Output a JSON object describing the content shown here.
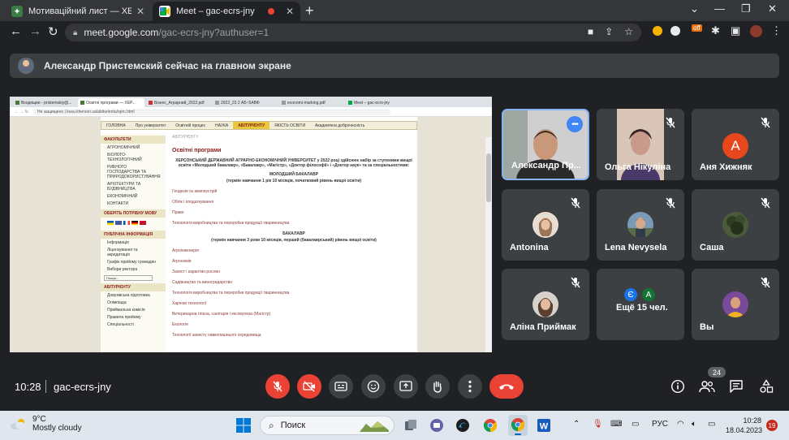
{
  "browser": {
    "tabs": [
      {
        "title": "Мотиваційний лист — ХЕРСОНСЬ",
        "active": false
      },
      {
        "title": "Meet – gac-ecrs-jny",
        "active": true
      }
    ],
    "url_host": "meet.google.com",
    "url_path": "/gac-ecrs-jny?authuser=1",
    "ext_badge": "off"
  },
  "meet": {
    "presenter_banner": "Александр Пристемский сейчас на главном экране",
    "clock": "10:28",
    "meeting_code": "gac-ecrs-jny",
    "participants_count": "24",
    "participants": [
      {
        "name": "Александр Пр...",
        "speaking": true
      },
      {
        "name": "Ольга Нікуліна"
      },
      {
        "name": "Аня Хижняк",
        "letter": "А"
      },
      {
        "name": "Antonina"
      },
      {
        "name": "Lena Nevysela"
      },
      {
        "name": "Саша"
      },
      {
        "name": "Аліна Приймак"
      },
      {
        "name": "Ещё 15 чел.",
        "letters": [
          "Є",
          "А"
        ]
      },
      {
        "name": "Вы"
      }
    ],
    "colors": {
      "accent": "#8ab4f8",
      "danger": "#ea4335",
      "tile": "#3c4043"
    }
  },
  "shared_screen": {
    "tabs": [
      "Входящие - pristemskiy@...",
      "Освітні програми — ХЕР...",
      "Бізнес_Аграрний_2022.pdf",
      "2022_23 2 АБ~5АВФ",
      "economi-marking.pdf",
      "Meet – gac-ecrs-jny"
    ],
    "url": "Не защищено | ksau.kherson.ua/abiturientu/oprc.html",
    "nav": [
      "ГОЛОВНА",
      "Про університет",
      "Освітній процес",
      "НАУКА",
      "АБІТУРІЄНТУ",
      "ЯКІСТЬ ОСВІТИ",
      "Академічна доброчесність"
    ],
    "side": {
      "h1": "ФАКУЛЬТЕТИ",
      "faculties": [
        "АГРОНОМІЧНИЙ",
        "БІОЛОГО-ТЕХНОЛОГІЧНИЙ",
        "РИБНОГО ГОСПОДАРСТВА ТА ПРИРОДОКОРИСТУВАННЯ",
        "АРХІТЕКТУРИ ТА БУДІВНИЦТВА",
        "ЕКОНОМІЧНИЙ",
        "КОНТАКТИ"
      ],
      "h2": "ОБЕРІТЬ ПОТРІБНУ МОВУ",
      "h3": "ПУБЛІЧНА ІНФОРМАЦІЯ",
      "public": [
        "Інформація",
        "Ліцензування та акредитація",
        "Графік прийому громадян",
        "Вибори ректора"
      ],
      "search": "Пошук...",
      "h4": "АБІТУРІЄНТУ",
      "abit": [
        "Довузівська підготовка",
        "Олімпіада",
        "Приймальна комісія",
        "Правила прийому",
        "Спеціальності"
      ]
    },
    "main": {
      "crumb": "АБІТУРІЄНТУ",
      "title": "Освітні програми",
      "intro": "ХЕРСОНСЬКИЙ ДЕРЖАВНИЙ АГРАРНО-ЕКОНОМІЧНИЙ УНІВЕРСИТЕТ у 2022 році здійснює набір за ступенями вищої освіти «Молодший бакалавр», «Бакалавр», «Магістр», «Доктор філософії» і «Доктор наук» та за спеціальностями:",
      "jb_title": "МОЛОДШИЙ БАКАЛАВР",
      "jb_term": "(термін навчання 1 рік 10 місяців, початковий рівень вищої освіти)",
      "jb_links": [
        "Геодезія та землеустрій",
        "Облік і оподаткування",
        "Право",
        "Технологія виробництва та переробки продукції тваринництва"
      ],
      "b_title": "БАКАЛАВР",
      "b_term": "(термін навчання 3 роки 10 місяців, перший (бакалаврський) рівень вищої освіти)",
      "b_links": [
        "Агроінженерія",
        "Агрономія",
        "Захист і карантин рослин",
        "Садівництво та виноградарство",
        "Технологія виробництва та переробки продукції тваринництва",
        "Харчові технології",
        "Ветеринарна гігієна, санітарія і експертиза (Магістр)",
        "Екологія",
        "Технології захисту навколишнього середовища"
      ]
    }
  },
  "taskbar": {
    "temp": "9°C",
    "weather": "Mostly cloudy",
    "search": "Поиск",
    "lang": "РУС",
    "time": "10:28",
    "date": "18.04.2023",
    "notifications": "19"
  }
}
